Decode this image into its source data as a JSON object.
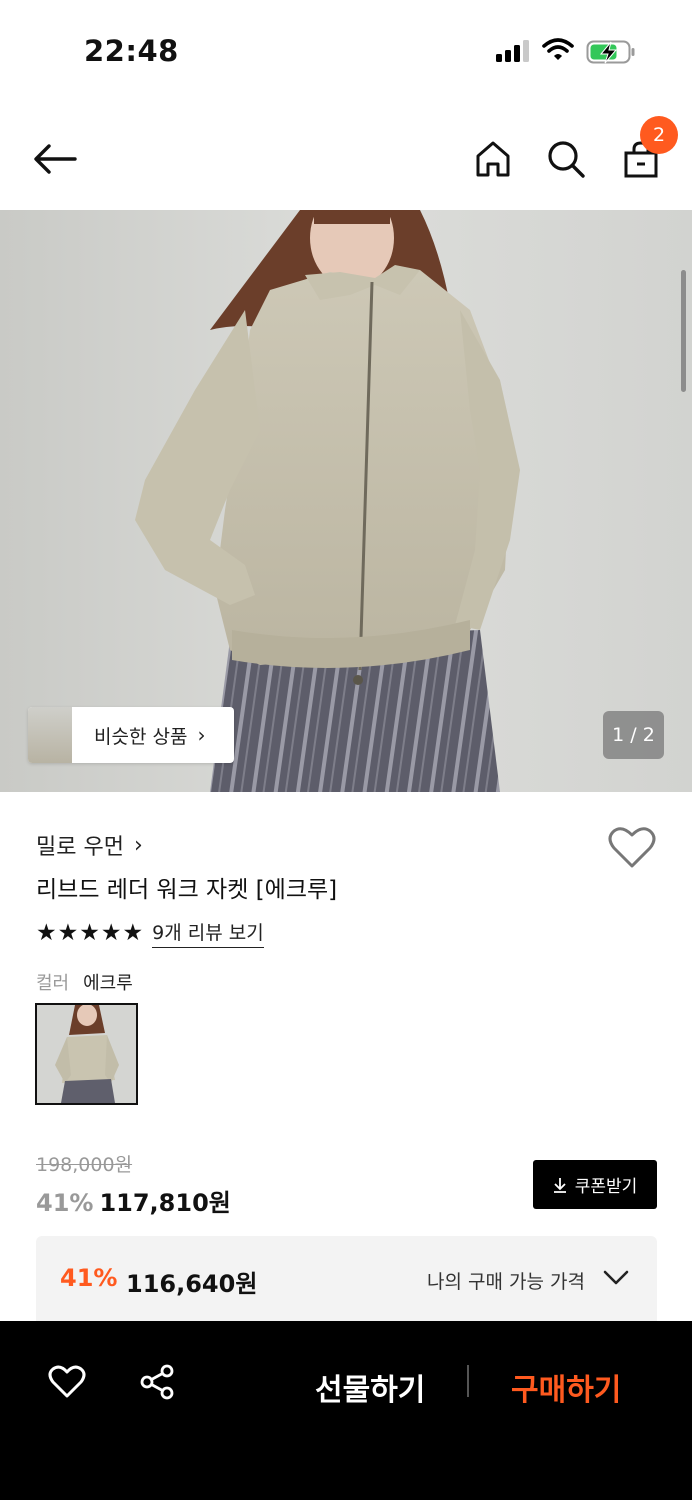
{
  "status_bar": {
    "time": "22:48"
  },
  "header": {
    "cart_count": "2"
  },
  "gallery": {
    "similar_label": "비슷한 상품",
    "pager": "1 / 2"
  },
  "product": {
    "brand": "밀로 우먼",
    "name": "리브드 레더 워크 자켓 [에크루]",
    "rating_stars": "★★★★★",
    "rating_value": 5,
    "review_link": "9개 리뷰 보기",
    "color_label": "컬러",
    "color_value": "에크루"
  },
  "pricing": {
    "original_price": "198,000원",
    "discount_rate": "41%",
    "sale_price": "117,810원",
    "coupon_label": "쿠폰받기",
    "my_discount_rate": "41%",
    "my_price": "116,640원",
    "my_price_label": "나의 구매 가능 가격"
  },
  "bottom_bar": {
    "gift_label": "선물하기",
    "buy_label": "구매하기"
  },
  "colors": {
    "accent": "#ff5a1f",
    "bottom_bar": "#000000"
  }
}
